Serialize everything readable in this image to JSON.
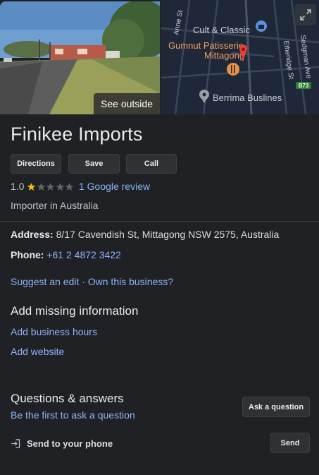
{
  "photos": {
    "see_outside_label": "See outside"
  },
  "map": {
    "labels": {
      "anne_st": "Anne St",
      "cult_classic": "Cult & Classic",
      "gumnut_line1": "Gumnut Patisserie",
      "gumnut_line2": "Mittagong",
      "etheridge": "Etheridge St",
      "sedgman": "Sedgman Ave",
      "berrima": "Berrima Buslines",
      "route": "B73"
    }
  },
  "business": {
    "name": "Finikee Imports",
    "rating": "1.0",
    "stars_filled": 1,
    "stars_total": 5,
    "review_link": "1 Google review",
    "category": "Importer in Australia",
    "address_label": "Address:",
    "address": "8/17 Cavendish St, Mittagong NSW 2575, Australia",
    "phone_label": "Phone:",
    "phone": "+61 2 4872 3422"
  },
  "actions": {
    "directions": "Directions",
    "save": "Save",
    "call": "Call"
  },
  "edit": {
    "suggest": "Suggest an edit",
    "separator": "·",
    "own": "Own this business?"
  },
  "missing": {
    "title": "Add missing information",
    "hours": "Add business hours",
    "website": "Add website"
  },
  "qa": {
    "title": "Questions & answers",
    "first": "Be the first to ask a question",
    "ask_button": "Ask a question"
  },
  "send": {
    "label": "Send to your phone",
    "button": "Send"
  },
  "colors": {
    "background": "#202124",
    "link": "#8ab4f8",
    "star": "#fbbc04",
    "star_empty": "#5f6368",
    "button_bg": "#303134"
  }
}
